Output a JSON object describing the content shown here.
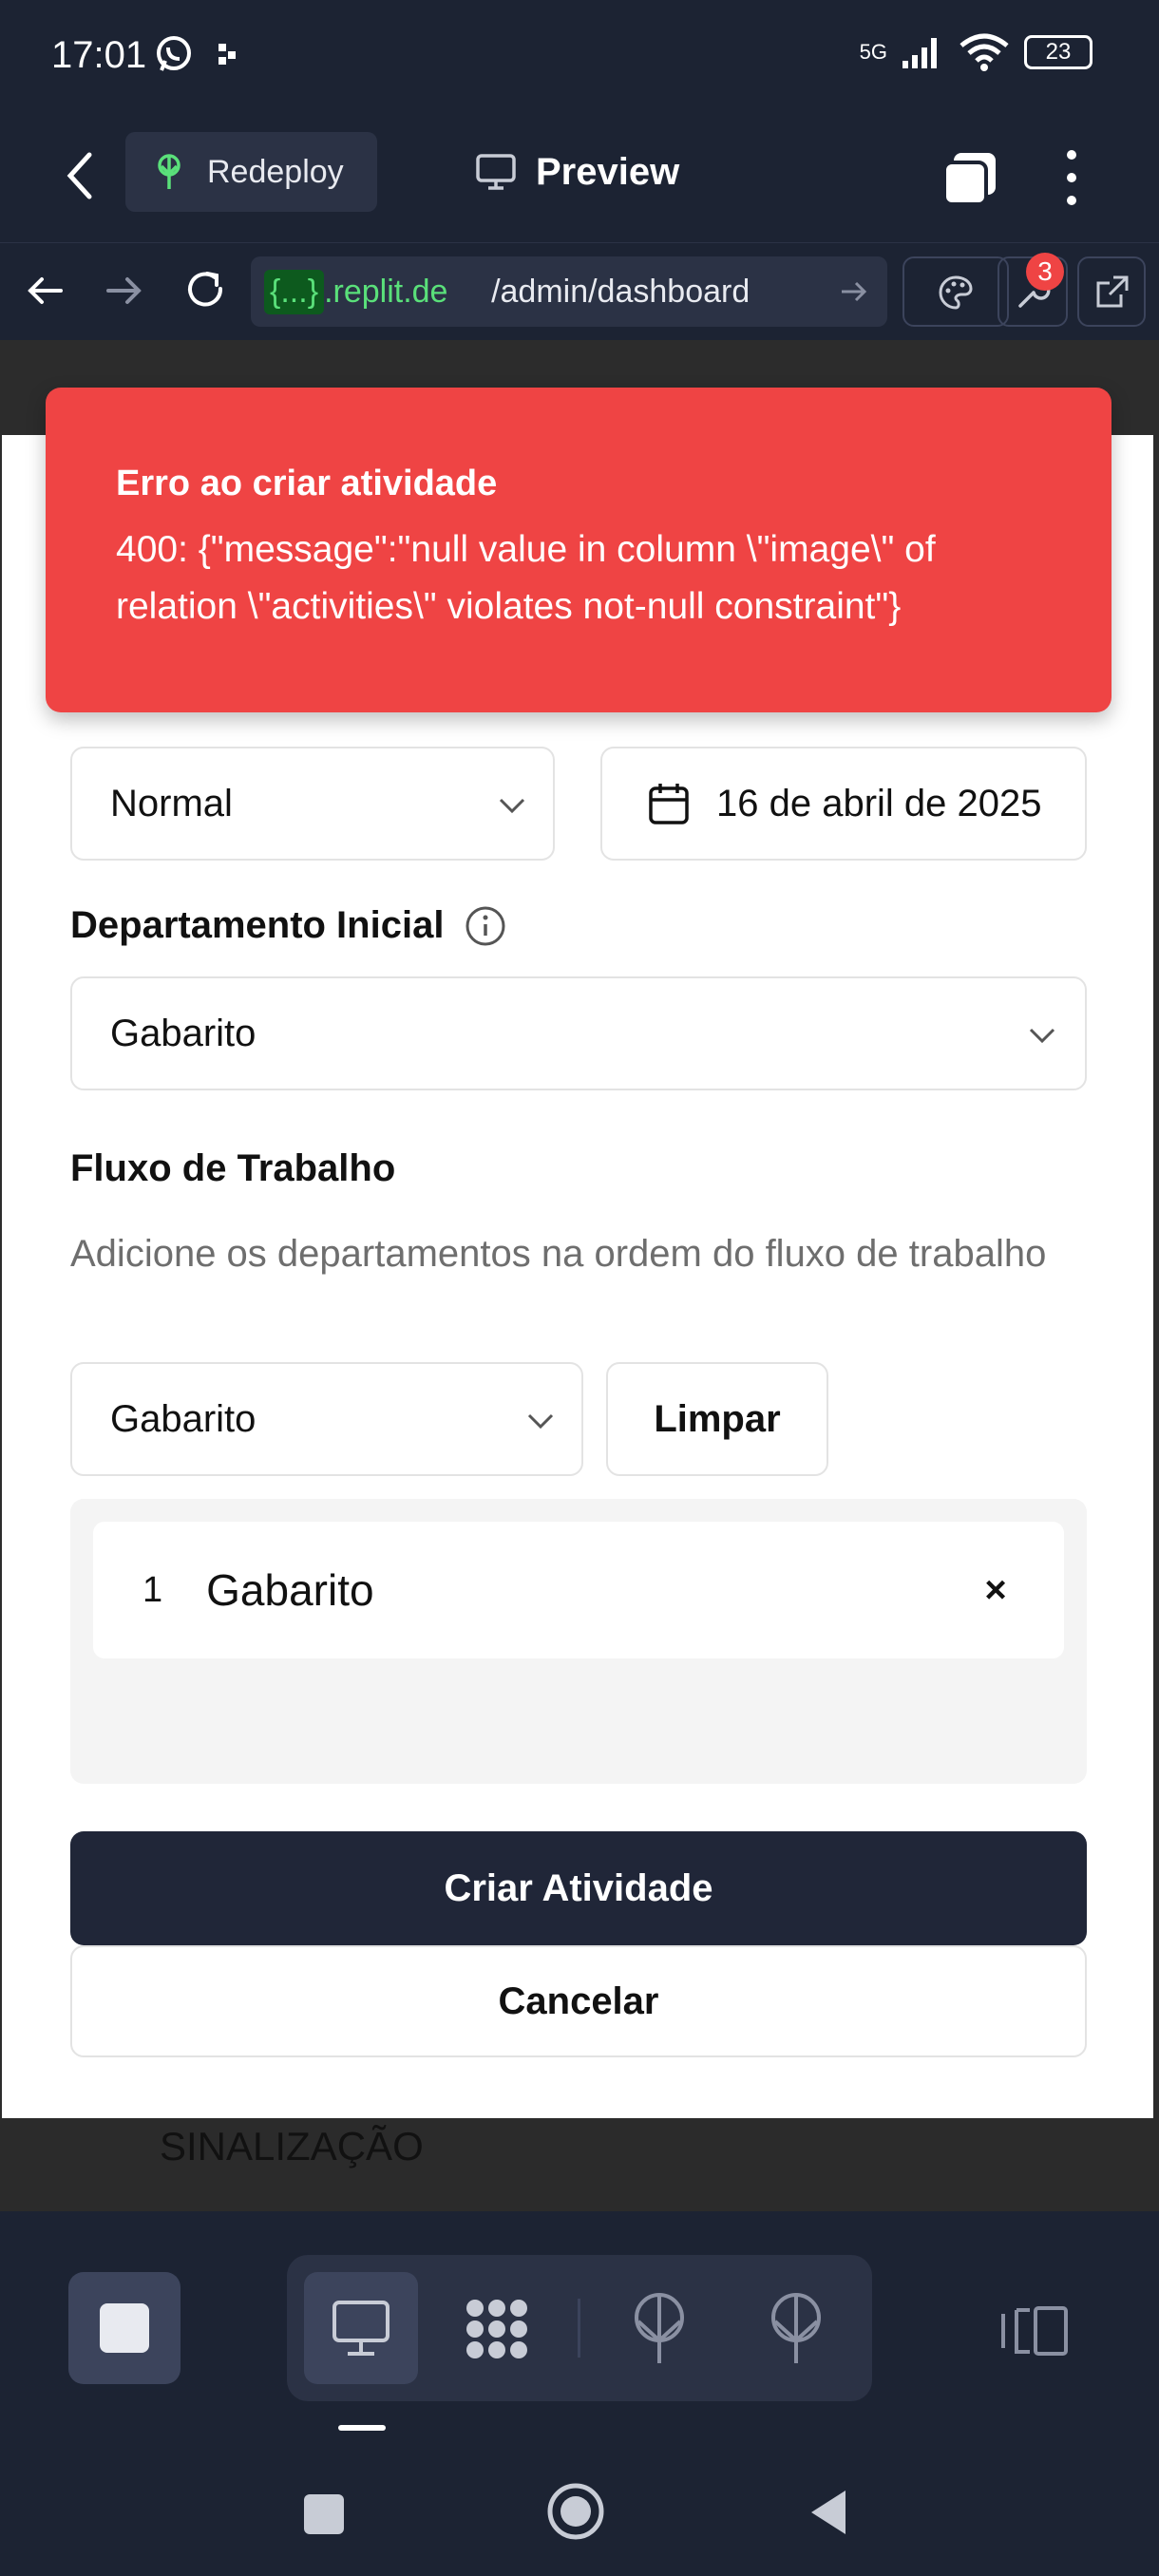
{
  "status_bar": {
    "time": "17:01",
    "network": "5G",
    "battery": "23"
  },
  "header": {
    "redeploy_label": "Redeploy",
    "preview_label": "Preview"
  },
  "url_bar": {
    "subdomain": "{...}",
    "domain": ".replit.de",
    "path": "/admin/dashboard",
    "badge_count": "3"
  },
  "toast": {
    "title": "Erro ao criar atividade",
    "message": "400: {\"message\":\"null value in column \\\"image\\\" of relation \\\"activities\\\" violates not-null constraint\"}"
  },
  "form": {
    "priority_value": "Normal",
    "date_value": "16 de abril de 2025",
    "department_label": "Departamento Inicial",
    "department_value": "Gabarito",
    "workflow_title": "Fluxo de Trabalho",
    "workflow_description": "Adicione os departamentos na ordem do fluxo de trabalho",
    "workflow_select_value": "Gabarito",
    "clear_label": "Limpar",
    "workflow_items": [
      {
        "number": "1",
        "label": "Gabarito",
        "remove": "×"
      }
    ],
    "create_label": "Criar Atividade",
    "cancel_label": "Cancelar"
  },
  "background": {
    "behind_text": "SINALIZAÇÃO"
  },
  "colors": {
    "toast_bg": "#ef4444",
    "primary_btn": "#202638",
    "replit_bg": "#1c2333"
  }
}
